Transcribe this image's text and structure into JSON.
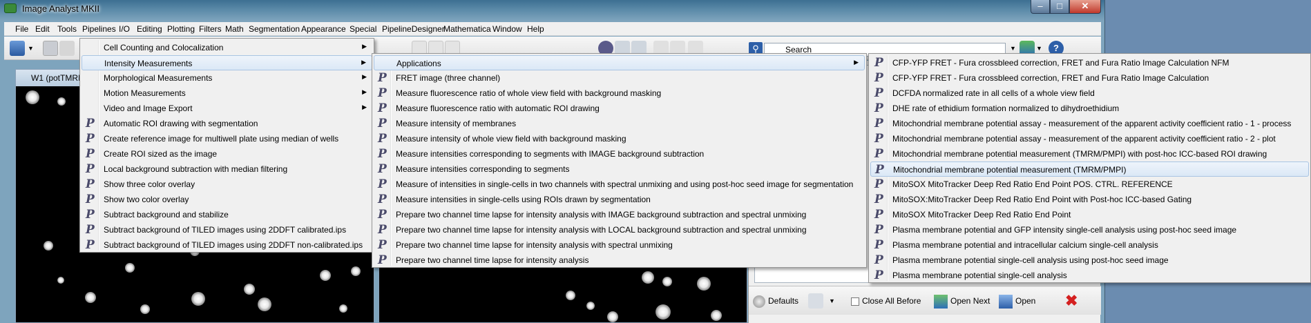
{
  "window": {
    "title": "Image Analyst MKII",
    "minimize": "–",
    "maximize": "□",
    "close": "✕"
  },
  "menubar": [
    "File",
    "Edit",
    "Tools",
    "Pipelines",
    "I/O",
    "Editing",
    "Plotting",
    "Filters",
    "Math",
    "Segmentation",
    "Appearance",
    "Special",
    "PipelineDesigner",
    "Mathematica",
    "Window",
    "Help"
  ],
  "toolbar": {
    "search_placeholder": "Search",
    "search_icon": "binoculars-icon"
  },
  "image_windows": [
    {
      "title": "W1 (potTMRI"
    }
  ],
  "right_panel": {
    "defaults": "Defaults",
    "close_all_before": "Close All Before",
    "open_next": "Open Next",
    "open": "Open",
    "close_icon": "✖"
  },
  "menus": {
    "pipelines": {
      "submenus": [
        "Cell Counting and Colocalization",
        "Intensity Measurements",
        "Morphological Measurements",
        "Motion Measurements",
        "Video and Image Export"
      ],
      "items": [
        "Automatic ROI drawing with segmentation",
        "Create reference image for multiwell plate using median of wells",
        "Create ROI sized as the image",
        "Local background subtraction with median filtering",
        "Show three color overlay",
        "Show two color overlay",
        "Subtract background and stabilize",
        "Subtract background of TILED images using 2DDFT calibrated.ips",
        "Subtract background of TILED images using 2DDFT non-calibrated.ips"
      ],
      "highlighted": "Intensity Measurements"
    },
    "intensity": {
      "submenus": [
        "Applications"
      ],
      "items": [
        "FRET image (three channel)",
        "Measure fluorescence ratio of whole view field with background masking",
        "Measure fluorescence ratio with automatic ROI drawing",
        "Measure intensity of membranes",
        "Measure intensity of whole view field with background masking",
        "Measure intensities corresponding to segments with IMAGE background subtraction",
        "Measure intensities corresponding to segments",
        "Measure of intensities in single-cells in two channels with spectral unmixing and using post-hoc seed image for segmentation",
        "Measure intensities in single-cells using ROIs drawn by segmentation",
        "Prepare two channel time lapse for intensity analysis with IMAGE background subtraction and spectral unmixing",
        "Prepare two channel time lapse for intensity analysis with LOCAL background subtraction and spectral unmixing",
        "Prepare two channel time lapse for intensity analysis with spectral unmixing",
        "Prepare two channel time lapse for intensity analysis"
      ],
      "highlighted": "Applications"
    },
    "applications": {
      "items": [
        "CFP-YFP FRET - Fura crossbleed correction, FRET and Fura Ratio Image Calculation NFM",
        "CFP-YFP FRET - Fura crossbleed correction, FRET and Fura Ratio Image Calculation",
        "DCFDA normalized rate in all cells of a whole view field",
        "DHE rate of ethidium formation normalized to dihydroethidium",
        "Mitochondrial membrane potential assay - measurement of the apparent activity coefficient ratio - 1 - process",
        "Mitochondrial membrane potential assay - measurement of the apparent activity coefficient ratio - 2 - plot",
        "Mitochondrial membrane potential measurement (TMRM/PMPI) with post-hoc ICC-based ROI drawing",
        "Mitochondrial membrane potential measurement (TMRM/PMPI)",
        "MitoSOX MitoTracker Deep Red Ratio End Point POS. CTRL. REFERENCE",
        "MitoSOX:MitoTracker Deep Red Ratio End Point with Post-hoc ICC-based Gating",
        "MitoSOX MitoTracker Deep Red Ratio End Point",
        "Plasma membrane potential and GFP intensity single-cell analysis using post-hoc seed image",
        "Plasma membrane potential and intracellular calcium single-cell analysis",
        "Plasma membrane potential single-cell analysis using post-hoc seed image",
        "Plasma membrane potential single-cell analysis"
      ],
      "highlighted": "Mitochondrial membrane potential measurement (TMRM/PMPI)"
    }
  },
  "colors": {
    "menu_bg": "#f0f0f0",
    "highlight_border": "#a9c4e3",
    "close_red": "#d42020"
  },
  "pipeline_icon_glyph": "P"
}
